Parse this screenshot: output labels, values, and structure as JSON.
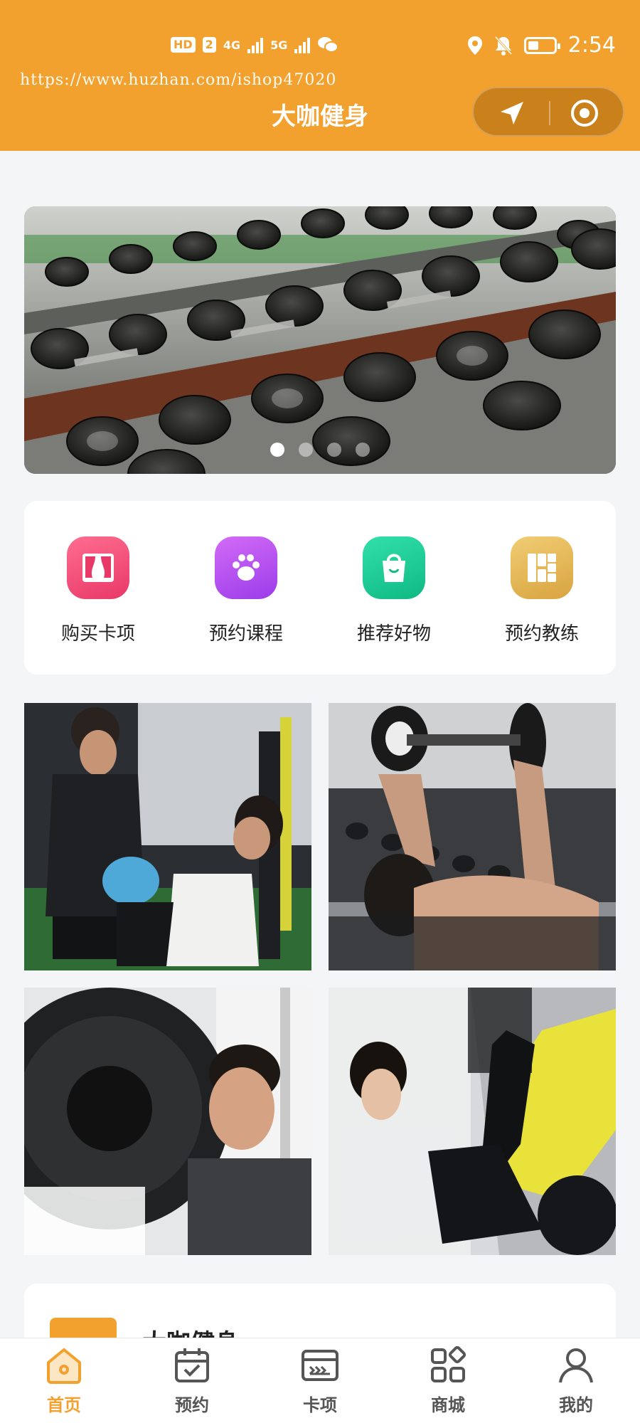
{
  "status_bar": {
    "hd_badge": "HD",
    "sim_badge": "2",
    "net1": "4G",
    "net2": "5G",
    "time": "2:54"
  },
  "header": {
    "watermark": "https://www.huzhan.com/ishop47020",
    "title": "大咖健身",
    "accent_color": "#f3a12e"
  },
  "banner": {
    "dot_count": 4,
    "active_index": 0
  },
  "quick_menu": [
    {
      "label": "购买卡项",
      "icon": "curtain-icon",
      "color": "#f04a78"
    },
    {
      "label": "预约课程",
      "icon": "paw-icon",
      "color": "#b356ec"
    },
    {
      "label": "推荐好物",
      "icon": "shopping-bag-icon",
      "color": "#1fcf9a"
    },
    {
      "label": "预约教练",
      "icon": "grid-blocks-icon",
      "color": "#e0b251"
    }
  ],
  "info_card": {
    "title": "大咖健身"
  },
  "tabbar": [
    {
      "label": "首页",
      "icon": "home-icon",
      "active": true
    },
    {
      "label": "预约",
      "icon": "calendar-check-icon",
      "active": false
    },
    {
      "label": "卡项",
      "icon": "card-icon",
      "active": false
    },
    {
      "label": "商城",
      "icon": "apps-icon",
      "active": false
    },
    {
      "label": "我的",
      "icon": "user-icon",
      "active": false
    }
  ]
}
